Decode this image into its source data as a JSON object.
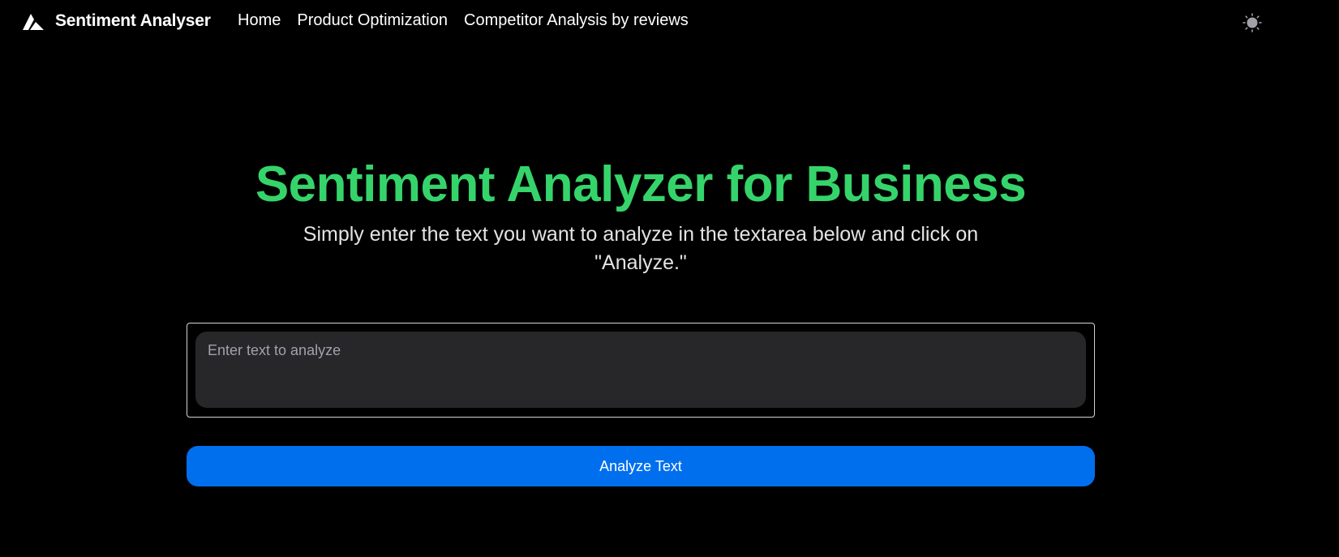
{
  "navbar": {
    "brand_name": "Sentiment Analyser",
    "brand_logo_icon": "triangle-logo-icon",
    "links": [
      {
        "label": "Home"
      },
      {
        "label": "Product Optimization"
      },
      {
        "label": "Competitor Analysis by reviews"
      }
    ],
    "theme_toggle_icon": "sun-icon"
  },
  "hero": {
    "title": "Sentiment Analyzer for Business",
    "subtitle": "Simply enter the text you want to analyze in the textarea below and click on \"Analyze.\""
  },
  "form": {
    "input_value": "",
    "input_placeholder": "Enter text to analyze",
    "button_label": "Analyze Text"
  },
  "colors": {
    "background": "#000000",
    "title_green": "#35d46b",
    "button_blue": "#006fee",
    "input_bg": "#27272a"
  }
}
